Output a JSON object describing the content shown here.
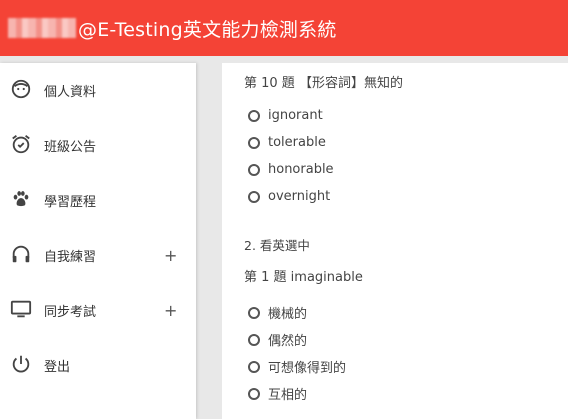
{
  "header": {
    "title": "@E-Testing英文能力檢測系統"
  },
  "sidebar": {
    "items": [
      {
        "label": "個人資料",
        "icon": "face-icon"
      },
      {
        "label": "班級公告",
        "icon": "alarm-icon"
      },
      {
        "label": "學習歷程",
        "icon": "paw-icon"
      },
      {
        "label": "自我練習",
        "icon": "headphones-icon",
        "expand": "+"
      },
      {
        "label": "同步考試",
        "icon": "monitor-icon",
        "expand": "+"
      },
      {
        "label": "登出",
        "icon": "power-icon"
      }
    ]
  },
  "main": {
    "question1": {
      "title": "第 10 題 【形容詞】無知的",
      "options": [
        "ignorant",
        "tolerable",
        "honorable",
        "overnight"
      ]
    },
    "section2": {
      "title": "2. 看英選中"
    },
    "question2": {
      "title": "第 1 題 imaginable",
      "options": [
        "機械的",
        "偶然的",
        "可想像得到的",
        "互相的"
      ]
    }
  },
  "colors": {
    "accent": "#f44336",
    "sidebar_bg": "#ffffff",
    "page_bg": "#e8e8e8"
  }
}
